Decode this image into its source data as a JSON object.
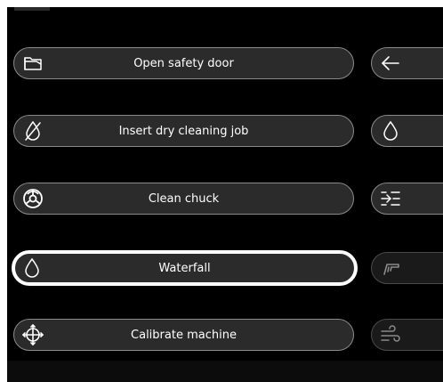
{
  "theme": {
    "background": "#000000",
    "button_fill": "#2b2b2b",
    "button_border": "#8a8a8a",
    "selected_border": "#ffffff",
    "text": "#ffffff"
  },
  "actions": [
    {
      "label": "Open safety door",
      "icon": "open-door-icon",
      "selected": false
    },
    {
      "label": "Insert dry cleaning job",
      "icon": "no-water-drop-icon",
      "selected": false
    },
    {
      "label": "Clean chuck",
      "icon": "chuck-icon",
      "selected": false
    },
    {
      "label": "Waterfall",
      "icon": "water-drop-icon",
      "selected": true
    },
    {
      "label": "Calibrate machine",
      "icon": "crosshair-icon",
      "selected": false
    }
  ],
  "side_actions": [
    {
      "icon": "arrow-left-icon",
      "enabled": true
    },
    {
      "icon": "water-drop-icon",
      "enabled": true
    },
    {
      "icon": "arrow-into-lines-icon",
      "enabled": true
    },
    {
      "icon": "nozzle-icon",
      "enabled": false
    },
    {
      "icon": "wind-icon",
      "enabled": false
    }
  ]
}
